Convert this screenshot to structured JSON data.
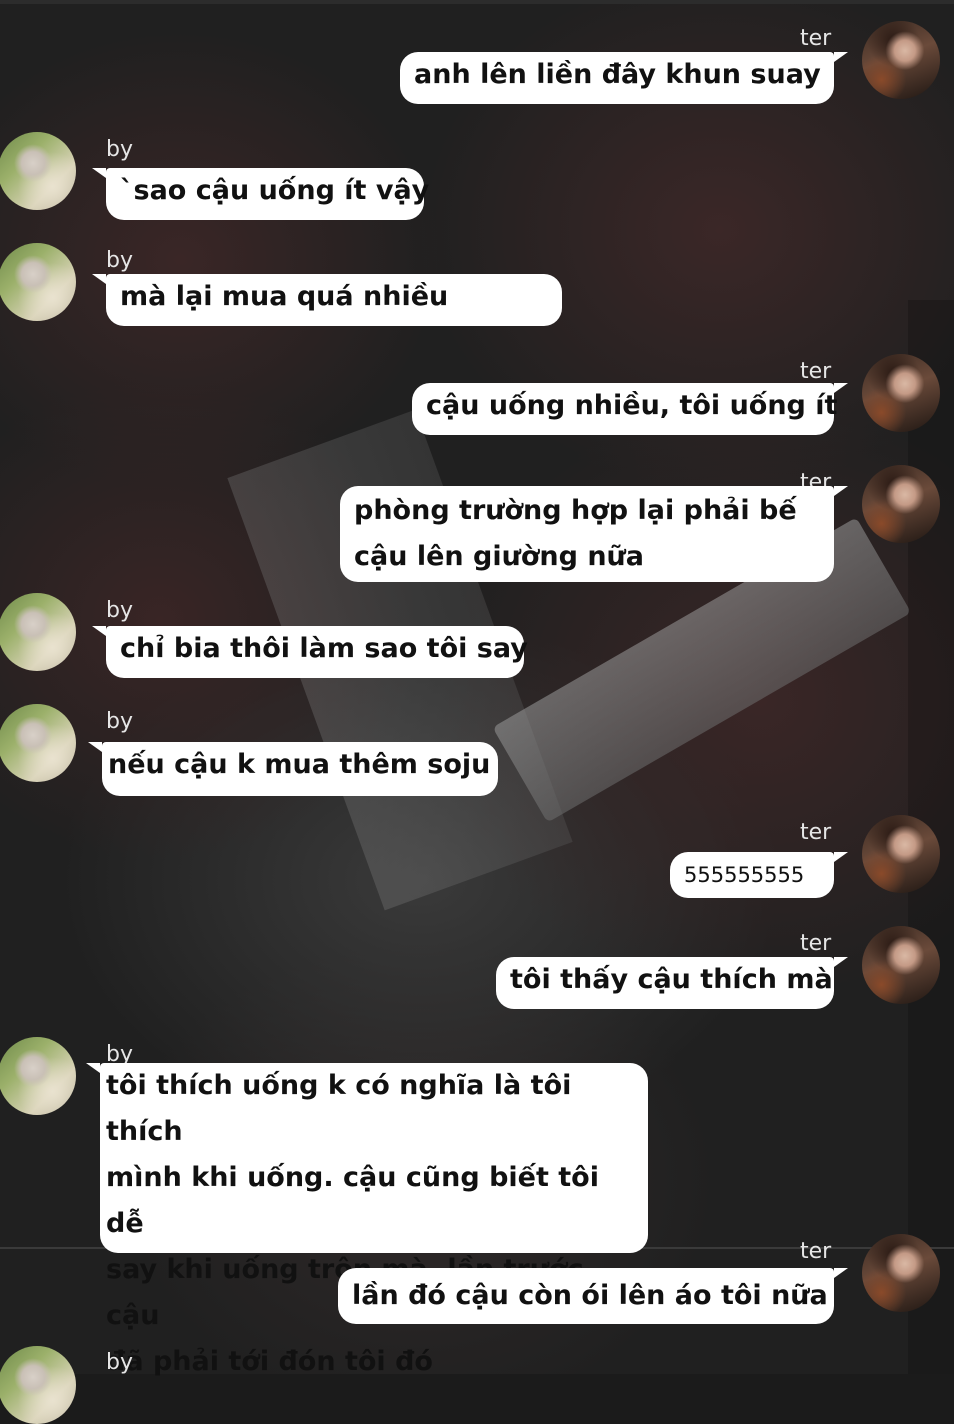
{
  "chat": {
    "messages": [
      {
        "sender": "ter",
        "text": "anh lên liền đây khun suay"
      },
      {
        "sender": "by",
        "text": "`sao cậu uống ít vậy"
      },
      {
        "sender": "by",
        "text": "mà lại mua quá nhiều"
      },
      {
        "sender": "ter",
        "text": "cậu uống nhiều, tôi uống ít"
      },
      {
        "sender": "ter",
        "lines": [
          "phòng trường hợp lại phải bế",
          "cậu lên giường nữa"
        ]
      },
      {
        "sender": "by",
        "text": "chỉ bia thôi làm sao tôi say"
      },
      {
        "sender": "by",
        "text": "nếu cậu k mua thêm soju"
      },
      {
        "sender": "ter",
        "text": "555555555"
      },
      {
        "sender": "ter",
        "text": "tôi thấy cậu thích mà"
      },
      {
        "sender": "by",
        "lines": [
          "tôi thích uống k có nghĩa là tôi thích",
          "mình khi uống. cậu cũng biết tôi dễ",
          "say khi uống trộn mà, lần trước cậu",
          "đã phải tới đón tôi đó"
        ]
      },
      {
        "sender": "ter",
        "text": "lần đó cậu còn ói lên áo tôi nữa"
      },
      {
        "sender": "by",
        "text": ""
      }
    ]
  },
  "colors": {
    "bubble": "#ffffff",
    "text": "#111111",
    "name": "#e6e6e6",
    "background": "#202020"
  },
  "icons": {
    "ter_avatar": "avatar-ter-icon",
    "by_avatar": "avatar-by-icon"
  }
}
